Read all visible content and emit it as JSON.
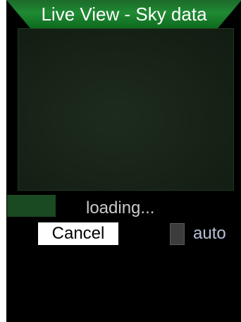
{
  "window": {
    "title": "Live View - Sky data"
  },
  "status": {
    "text": "loading..."
  },
  "actions": {
    "cancel_label": "Cancel",
    "auto_label": "auto",
    "auto_checked": false
  },
  "colors": {
    "title_bar": "#1f8a33",
    "preview_background": "#172317",
    "progress_fill": "#1a4a22",
    "status_text": "#c9c9c9",
    "auto_label": "#b7c0d8"
  }
}
